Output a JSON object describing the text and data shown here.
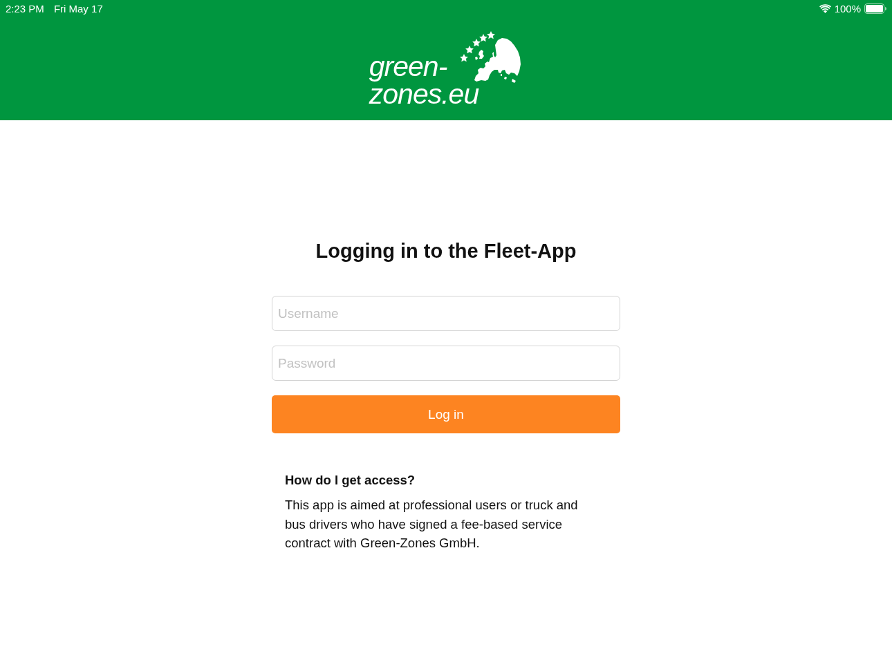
{
  "status_bar": {
    "time": "2:23 PM",
    "date": "Fri May 17",
    "battery": "100%"
  },
  "header": {
    "logo_lines": [
      "green-",
      "zones.eu"
    ]
  },
  "login": {
    "title": "Logging in to the Fleet-App",
    "username": {
      "placeholder": "Username"
    },
    "password": {
      "placeholder": "Password"
    },
    "button": "Log in"
  },
  "help": {
    "heading": "How do I get access?",
    "text": "This app is aimed at professional users or truck and bus drivers who have signed a fee-based service contract with Green-Zones GmbH."
  }
}
